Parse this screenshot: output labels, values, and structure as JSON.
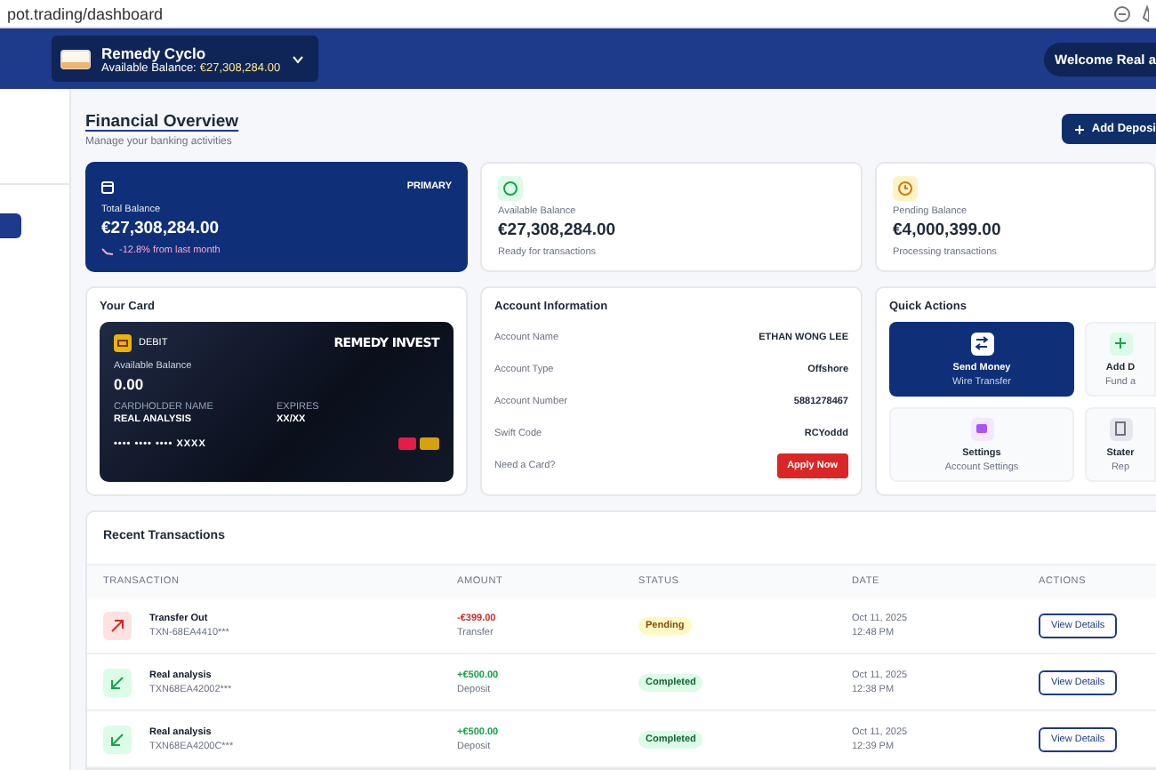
{
  "browser": {
    "url": "pot.trading/dashboard"
  },
  "header": {
    "account_name": "Remedy Cyclo",
    "balance_label": "Available Balance:",
    "balance_value": "€27,308,284.00",
    "welcome": "Welcome Real a"
  },
  "sidebar": {
    "items": [
      {
        "selected": true
      }
    ]
  },
  "overview": {
    "title": "Financial Overview",
    "subtitle": "Manage your banking activities",
    "add_button": "Add Deposi"
  },
  "stats": [
    {
      "kind": "primary",
      "badge": "PRIMARY",
      "label": "Total Balance",
      "value": "€27,308,284.00",
      "note": "-12.8% from last month"
    },
    {
      "kind": "available",
      "label": "Available Balance",
      "value": "€27,308,284.00",
      "note": "Ready for transactions"
    },
    {
      "kind": "pending",
      "label": "Pending Balance",
      "value": "€4,000,399.00",
      "note": "Processing transactions"
    }
  ],
  "card_panel": {
    "title": "Your Card",
    "card": {
      "type": "DEBIT",
      "brand": "REMEDY INVEST",
      "balance_label": "Available Balance",
      "balance": "0.00",
      "holder_label": "CARDHOLDER NAME",
      "holder": "REAL ANALYSIS",
      "expires_label": "EXPIRES",
      "expires": "XX/XX",
      "number": "•••• •••• •••• XXXX"
    }
  },
  "account_info": {
    "title": "Account Information",
    "rows": [
      {
        "label": "Account Name",
        "value": "ETHAN WONG LEE"
      },
      {
        "label": "Account Type",
        "value": "Offshore"
      },
      {
        "label": "Account Number",
        "value": "5881278467"
      },
      {
        "label": "Swift Code",
        "value": "RCYoddd"
      }
    ],
    "prompt": "Need a Card?",
    "button": "Apply Now"
  },
  "quick_actions": {
    "title": "Quick Actions",
    "items": [
      {
        "kind": "transfer",
        "selected": true,
        "title": "Send Money",
        "subtitle": "Wire Transfer"
      },
      {
        "kind": "deposit",
        "selected": false,
        "title": "Add D",
        "subtitle": "Fund a"
      },
      {
        "kind": "settings",
        "selected": false,
        "title": "Settings",
        "subtitle": "Account Settings"
      },
      {
        "kind": "statement",
        "selected": false,
        "title": "Stater",
        "subtitle": "Rep"
      }
    ]
  },
  "transactions": {
    "title": "Recent Transactions",
    "columns": [
      "TRANSACTION",
      "AMOUNT",
      "STATUS",
      "DATE",
      "ACTIONS"
    ],
    "rows": [
      {
        "kind": "out",
        "name": "Transfer Out",
        "ref": "TXN-68EA4410***",
        "amount": "-€399.00",
        "type": "Transfer",
        "status": {
          "kind": "pending",
          "label": "Pending"
        },
        "date": "Oct 11, 2025",
        "time": "12:48 PM",
        "action": "View Details"
      },
      {
        "kind": "in",
        "name": "Real analysis",
        "ref": "TXN68EA42002***",
        "amount": "+€500.00",
        "type": "Deposit",
        "status": {
          "kind": "completed",
          "label": "Completed"
        },
        "date": "Oct 11, 2025",
        "time": "12:38 PM",
        "action": "View Details"
      },
      {
        "kind": "in",
        "name": "Real analysis",
        "ref": "TXN68EA4200C***",
        "amount": "+€500.00",
        "type": "Deposit",
        "status": {
          "kind": "completed",
          "label": "Completed"
        },
        "date": "Oct 11, 2025",
        "time": "12:39 PM",
        "action": "View Details"
      }
    ]
  }
}
